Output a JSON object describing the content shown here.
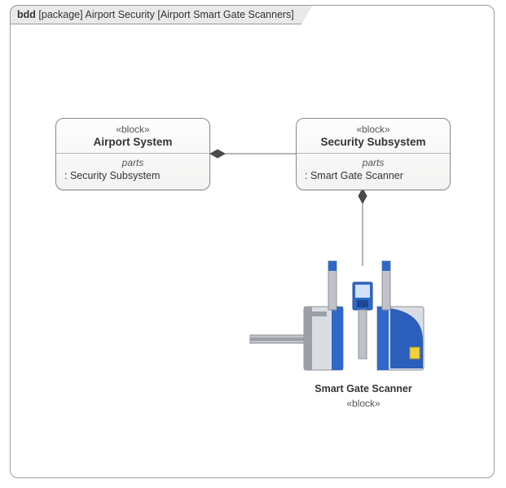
{
  "frame": {
    "kind": "bdd",
    "kind_bracket": "[package]",
    "package": "Airport Security",
    "name": "[Airport Smart Gate Scanners]"
  },
  "blocks": {
    "airport_system": {
      "stereotype": "«block»",
      "name": "Airport System",
      "compartment_label": "parts",
      "parts": [
        ": Security Subsystem"
      ]
    },
    "security_subsystem": {
      "stereotype": "«block»",
      "name": "Security Subsystem",
      "compartment_label": "parts",
      "parts": [
        ": Smart Gate Scanner"
      ]
    },
    "smart_gate_scanner": {
      "name": "Smart Gate Scanner",
      "stereotype": "«block»"
    }
  },
  "chart_data": {
    "type": "diagram",
    "notation": "SysML Block Definition Diagram (bdd)",
    "frame": {
      "kind": "package",
      "package_name": "Airport Security",
      "diagram_name": "Airport Smart Gate Scanners"
    },
    "blocks": [
      {
        "id": "airport_system",
        "name": "Airport System",
        "stereotype": "block",
        "parts": [
          "Security Subsystem"
        ]
      },
      {
        "id": "security_subsystem",
        "name": "Security Subsystem",
        "stereotype": "block",
        "parts": [
          "Smart Gate Scanner"
        ]
      },
      {
        "id": "smart_gate_scanner",
        "name": "Smart Gate Scanner",
        "stereotype": "block",
        "rendered_as": "image"
      }
    ],
    "relationships": [
      {
        "type": "composition",
        "whole": "airport_system",
        "part": "security_subsystem"
      },
      {
        "type": "composition",
        "whole": "security_subsystem",
        "part": "smart_gate_scanner"
      }
    ]
  }
}
